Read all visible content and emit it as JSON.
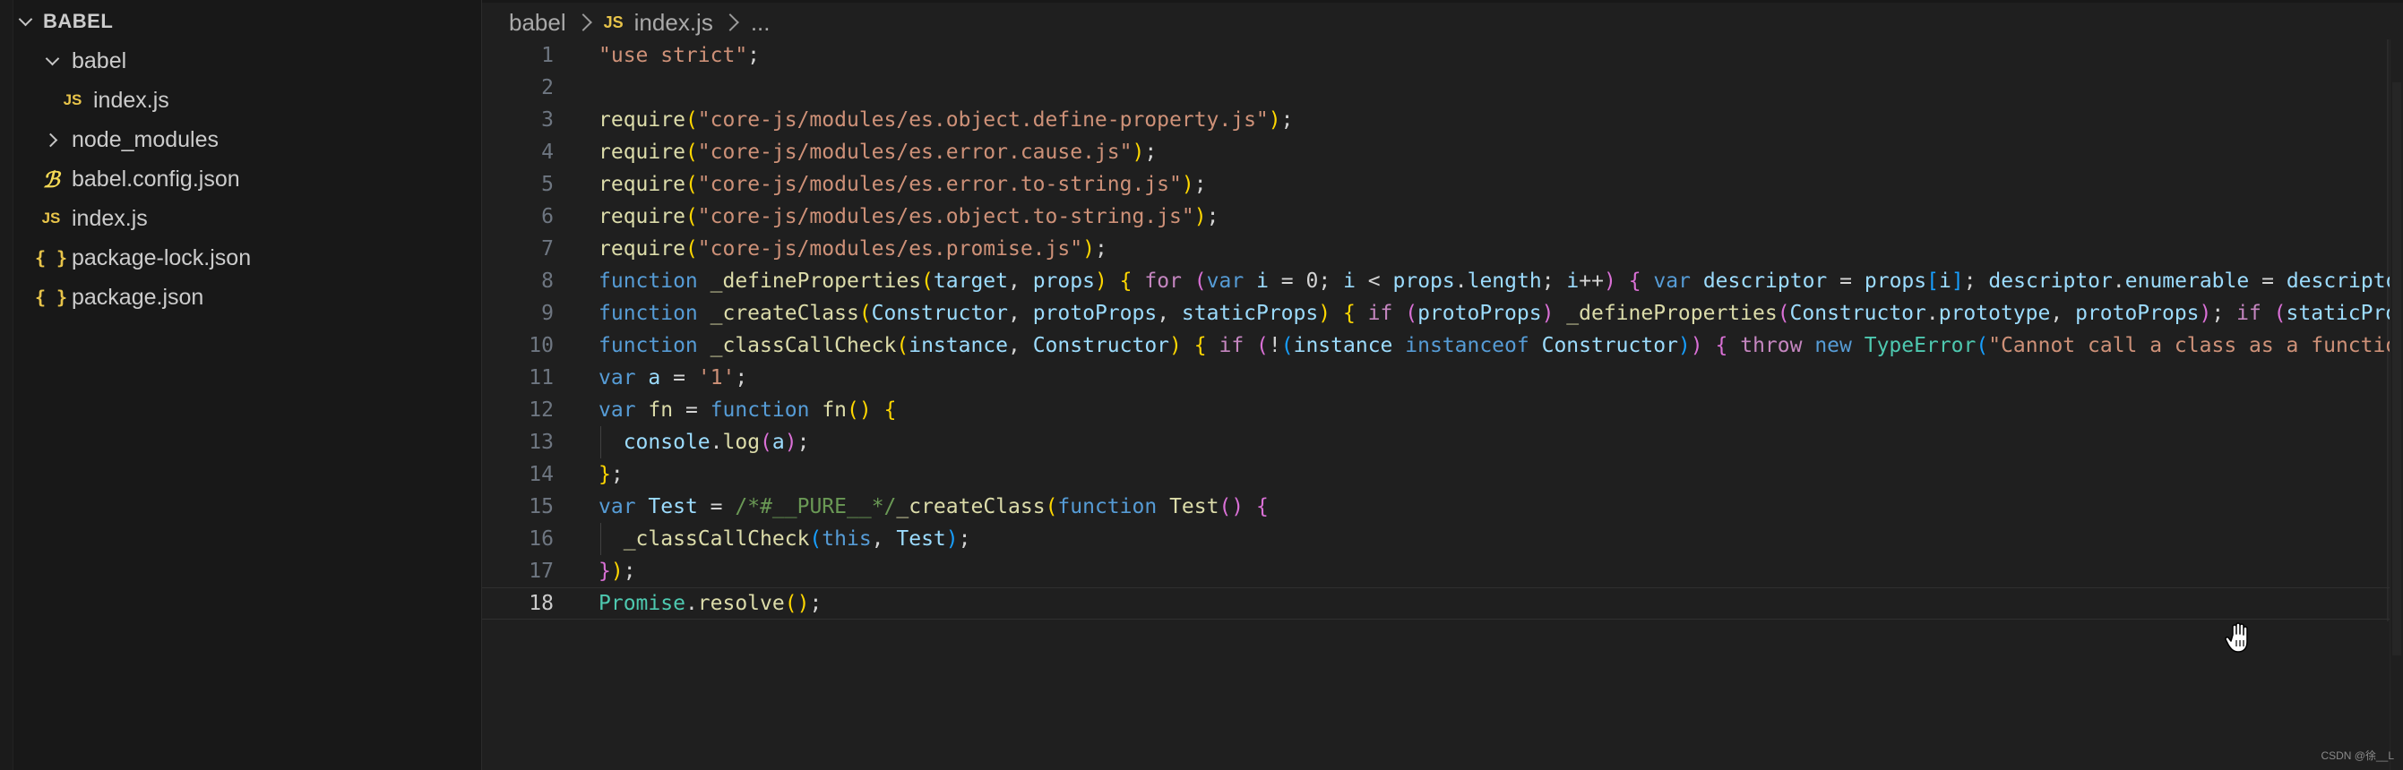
{
  "explorer": {
    "title": "BABEL",
    "items": [
      {
        "label": "babel",
        "kind": "folder-open",
        "icon": "chevron-down-icon"
      },
      {
        "label": "index.js",
        "kind": "file",
        "icon_text": "JS"
      },
      {
        "label": "node_modules",
        "kind": "folder-closed",
        "icon": "chevron-right-icon"
      },
      {
        "label": "babel.config.json",
        "kind": "file",
        "icon_text": "ℬ"
      },
      {
        "label": "index.js",
        "kind": "file",
        "icon_text": "JS"
      },
      {
        "label": "package-lock.json",
        "kind": "file",
        "icon_text": "{ }"
      },
      {
        "label": "package.json",
        "kind": "file",
        "icon_text": "{ }"
      }
    ]
  },
  "breadcrumb": {
    "folder": "babel",
    "file_icon": "JS",
    "file": "index.js",
    "more": "..."
  },
  "editor": {
    "current_line": 18,
    "line_numbers": [
      "1",
      "2",
      "3",
      "4",
      "5",
      "6",
      "7",
      "8",
      "9",
      "10",
      "11",
      "12",
      "13",
      "14",
      "15",
      "16",
      "17",
      "18"
    ]
  },
  "colors": {
    "string": "#ce9178",
    "keyword": "#569cd6",
    "control": "#c586c0",
    "function": "#dcdcaa",
    "variable": "#9cdcfe",
    "type": "#4ec9b0",
    "comment": "#6a9955"
  },
  "watermark": "CSDN @徐__L"
}
